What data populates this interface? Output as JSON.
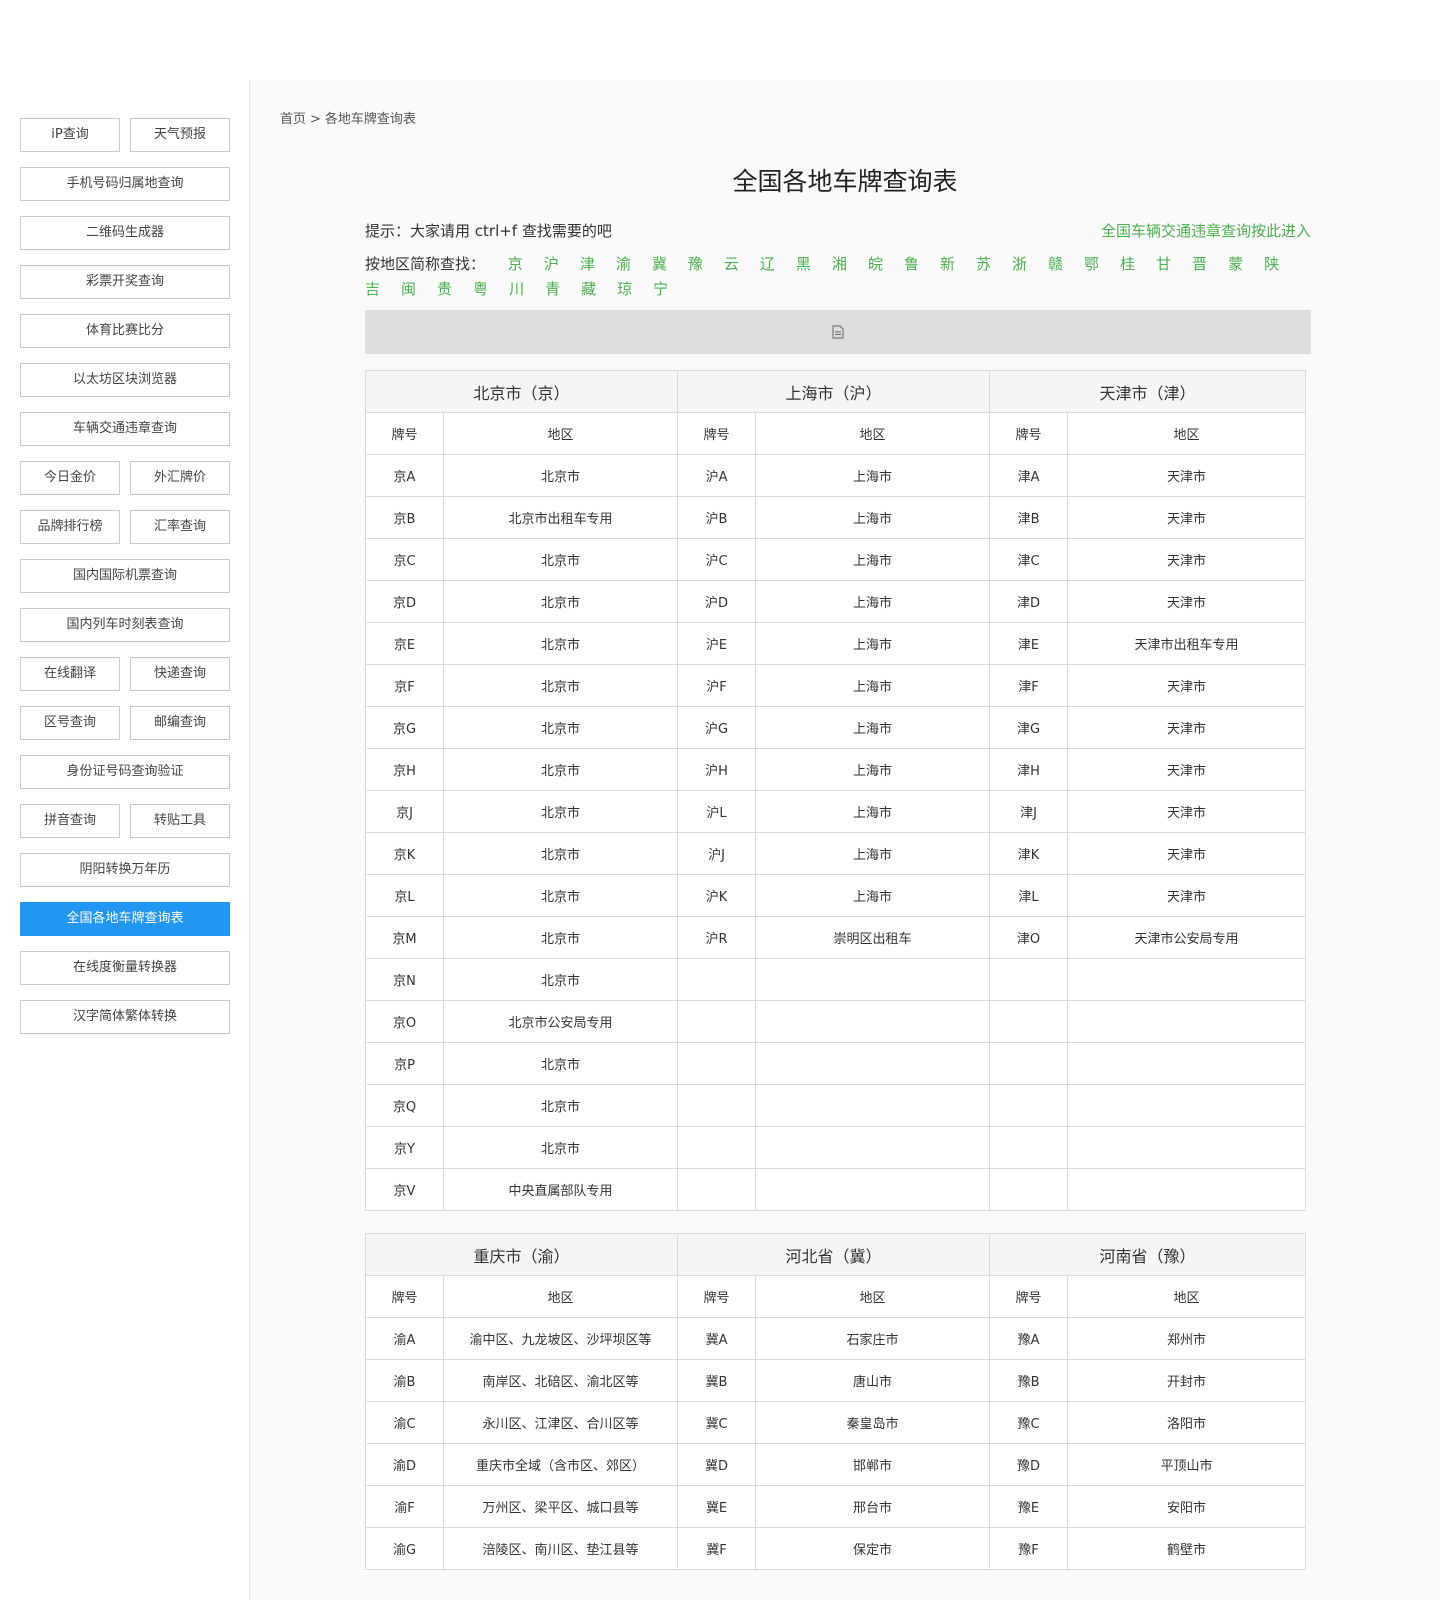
{
  "sidebar": {
    "rows": [
      [
        {
          "label": "iP查询"
        },
        {
          "label": "天气预报"
        }
      ],
      [
        {
          "label": "手机号码归属地查询"
        }
      ],
      [
        {
          "label": "二维码生成器"
        }
      ],
      [
        {
          "label": "彩票开奖查询"
        }
      ],
      [
        {
          "label": "体育比赛比分"
        }
      ],
      [
        {
          "label": "以太坊区块浏览器"
        }
      ],
      [
        {
          "label": "车辆交通违章查询"
        }
      ],
      [
        {
          "label": "今日金价"
        },
        {
          "label": "外汇牌价"
        }
      ],
      [
        {
          "label": "品牌排行榜"
        },
        {
          "label": "汇率查询"
        }
      ],
      [
        {
          "label": "国内国际机票查询"
        }
      ],
      [
        {
          "label": "国内列车时刻表查询"
        }
      ],
      [
        {
          "label": "在线翻译"
        },
        {
          "label": "快递查询"
        }
      ],
      [
        {
          "label": "区号查询"
        },
        {
          "label": "邮编查询"
        }
      ],
      [
        {
          "label": "身份证号码查询验证"
        }
      ],
      [
        {
          "label": "拼音查询"
        },
        {
          "label": "转贴工具"
        }
      ],
      [
        {
          "label": "阴阳转换万年历"
        }
      ],
      [
        {
          "label": "全国各地车牌查询表",
          "active": true
        }
      ],
      [
        {
          "label": "在线度衡量转换器"
        }
      ],
      [
        {
          "label": "汉字简体繁体转换"
        }
      ]
    ]
  },
  "breadcrumb": {
    "home": "首页",
    "sep": ">",
    "current": "各地车牌查询表"
  },
  "page_title": "全国各地车牌查询表",
  "tip": "提示：大家请用 ctrl+f 查找需要的吧",
  "violation_link": "全国车辆交通违章查询按此进入",
  "abbr_label": "按地区简称查找：",
  "abbreviations": [
    "京",
    "沪",
    "津",
    "渝",
    "冀",
    "豫",
    "云",
    "辽",
    "黑",
    "湘",
    "皖",
    "鲁",
    "新",
    "苏",
    "浙",
    "赣",
    "鄂",
    "桂",
    "甘",
    "晋",
    "蒙",
    "陕",
    "吉",
    "闽",
    "贵",
    "粤",
    "川",
    "青",
    "藏",
    "琼",
    "宁"
  ],
  "column_headers": {
    "plate": "牌号",
    "area": "地区"
  },
  "tables": [
    {
      "regions": [
        "北京市（京）",
        "上海市（沪）",
        "天津市（津）"
      ],
      "rows": [
        [
          "京A",
          "北京市",
          "沪A",
          "上海市",
          "津A",
          "天津市"
        ],
        [
          "京B",
          "北京市出租车专用",
          "沪B",
          "上海市",
          "津B",
          "天津市"
        ],
        [
          "京C",
          "北京市",
          "沪C",
          "上海市",
          "津C",
          "天津市"
        ],
        [
          "京D",
          "北京市",
          "沪D",
          "上海市",
          "津D",
          "天津市"
        ],
        [
          "京E",
          "北京市",
          "沪E",
          "上海市",
          "津E",
          "天津市出租车专用"
        ],
        [
          "京F",
          "北京市",
          "沪F",
          "上海市",
          "津F",
          "天津市"
        ],
        [
          "京G",
          "北京市",
          "沪G",
          "上海市",
          "津G",
          "天津市"
        ],
        [
          "京H",
          "北京市",
          "沪H",
          "上海市",
          "津H",
          "天津市"
        ],
        [
          "京J",
          "北京市",
          "沪L",
          "上海市",
          "津J",
          "天津市"
        ],
        [
          "京K",
          "北京市",
          "沪J",
          "上海市",
          "津K",
          "天津市"
        ],
        [
          "京L",
          "北京市",
          "沪K",
          "上海市",
          "津L",
          "天津市"
        ],
        [
          "京M",
          "北京市",
          "沪R",
          "崇明区出租车",
          "津O",
          "天津市公安局专用"
        ],
        [
          "京N",
          "北京市",
          "",
          "",
          "",
          ""
        ],
        [
          "京O",
          "北京市公安局专用",
          "",
          "",
          "",
          ""
        ],
        [
          "京P",
          "北京市",
          "",
          "",
          "",
          ""
        ],
        [
          "京Q",
          "北京市",
          "",
          "",
          "",
          ""
        ],
        [
          "京Y",
          "北京市",
          "",
          "",
          "",
          ""
        ],
        [
          "京V",
          "中央直属部队专用",
          "",
          "",
          "",
          ""
        ]
      ]
    },
    {
      "regions": [
        "重庆市（渝）",
        "河北省（冀）",
        "河南省（豫）"
      ],
      "rows": [
        [
          "渝A",
          "渝中区、九龙坡区、沙坪坝区等",
          "冀A",
          "石家庄市",
          "豫A",
          "郑州市"
        ],
        [
          "渝B",
          "南岸区、北碚区、渝北区等",
          "冀B",
          "唐山市",
          "豫B",
          "开封市"
        ],
        [
          "渝C",
          "永川区、江津区、合川区等",
          "冀C",
          "秦皇岛市",
          "豫C",
          "洛阳市"
        ],
        [
          "渝D",
          "重庆市全域（含市区、郊区）",
          "冀D",
          "邯郸市",
          "豫D",
          "平顶山市"
        ],
        [
          "渝F",
          "万州区、梁平区、城口县等",
          "冀E",
          "邢台市",
          "豫E",
          "安阳市"
        ],
        [
          "渝G",
          "涪陵区、南川区、垫江县等",
          "冀F",
          "保定市",
          "豫F",
          "鹤壁市"
        ]
      ]
    }
  ]
}
